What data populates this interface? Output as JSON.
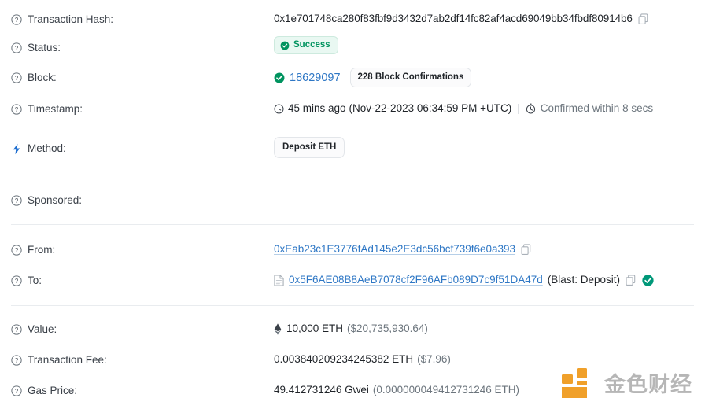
{
  "rows": {
    "hash": {
      "label": "Transaction Hash:",
      "value": "0x1e701748ca280f83fbf9d3432d7ab2df14fc82af4acd69049bb34fbdf80914b6",
      "copy_icon": "copy-icon"
    },
    "status": {
      "label": "Status:",
      "badge": "Success",
      "badge_icon": "check-circle-icon"
    },
    "block": {
      "label": "Block:",
      "icon": "check-circle-icon",
      "number": "18629097",
      "confirmations": "228 Block Confirmations"
    },
    "timestamp": {
      "label": "Timestamp:",
      "clock_icon": "clock-icon",
      "age": "45 mins ago",
      "absolute": "(Nov-22-2023 06:34:59 PM +UTC)",
      "separator": "|",
      "stopwatch_icon": "stopwatch-icon",
      "confirmed": "Confirmed within 8 secs"
    },
    "method": {
      "label": "Method:",
      "icon": "lightning-bolt-icon",
      "badge": "Deposit ETH"
    },
    "sponsored": {
      "label": "Sponsored:",
      "value": ""
    },
    "from": {
      "label": "From:",
      "address": "0xEab23c1E3776fAd145e2E3dc56bcf739f6e0a393",
      "copy_icon": "copy-icon"
    },
    "to": {
      "label": "To:",
      "contract_icon": "contract-document-icon",
      "address": "0x5F6AE08B8AeB7078cf2F96AFb089D7c9f51DA47d",
      "tag": "(Blast: Deposit)",
      "copy_icon": "copy-icon",
      "verified_icon": "verified-check-icon"
    },
    "value": {
      "label": "Value:",
      "icon": "ethereum-diamond-icon",
      "amount": "10,000 ETH",
      "usd": "($20,735,930.64)"
    },
    "fee": {
      "label": "Transaction Fee:",
      "amount": "0.003840209234245382 ETH",
      "usd": "($7.96)"
    },
    "gas": {
      "label": "Gas Price:",
      "amount": "49.412731246 Gwei",
      "eth": "(0.000000049412731246 ETH)"
    }
  },
  "watermark": {
    "logo_icon": "jinse-logo-icon",
    "text": "金色财经"
  },
  "colors": {
    "link": "#2e77c5",
    "success_green": "#00935f",
    "success_bg": "#e9f8f2",
    "method_blue": "#1f6fd0",
    "muted": "#6c757d",
    "divider": "#e9ecef",
    "watermark_orange": "#f0a02a",
    "watermark_gray": "#b6b6b6"
  }
}
